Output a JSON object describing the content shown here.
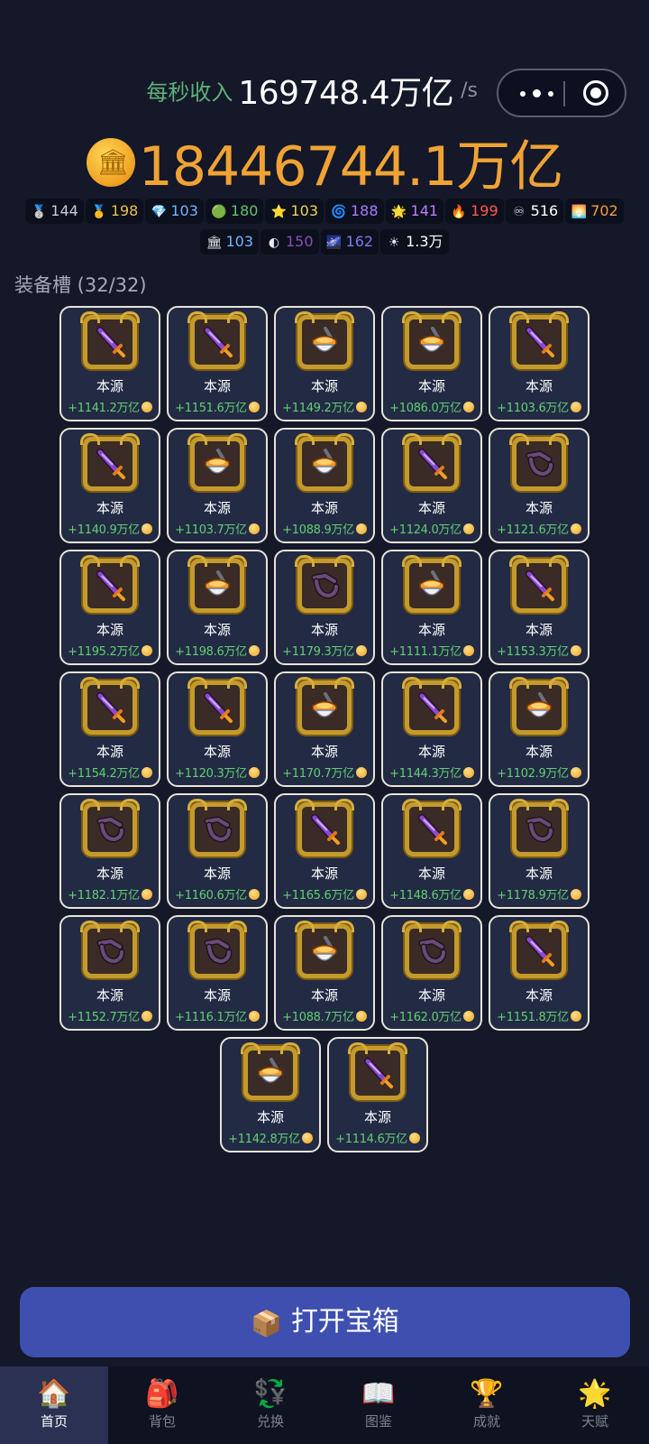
{
  "header": {
    "income_label": "每秒收入",
    "income_value": "169748.4万亿",
    "income_unit": "/s",
    "balance_value": "18446744.1万亿"
  },
  "badges_row1": [
    {
      "icon": "silver-medal-icon",
      "glyph": "🥈",
      "value": "144",
      "color": "#c8ccd6"
    },
    {
      "icon": "gold-medal-icon",
      "glyph": "🥇",
      "value": "198",
      "color": "#e8c04a"
    },
    {
      "icon": "diamond-icon",
      "glyph": "💎",
      "value": "103",
      "color": "#6fb6ff"
    },
    {
      "icon": "green-orb-icon",
      "glyph": "🟢",
      "value": "180",
      "color": "#62c26a"
    },
    {
      "icon": "star-icon",
      "glyph": "⭐",
      "value": "103",
      "color": "#f2d05a"
    },
    {
      "icon": "galaxy-icon",
      "glyph": "🌀",
      "value": "188",
      "color": "#a77bff"
    },
    {
      "icon": "sun-icon",
      "glyph": "🌟",
      "value": "141",
      "color": "#c07cff"
    },
    {
      "icon": "fire-icon",
      "glyph": "🔥",
      "value": "199",
      "color": "#ff5a4a"
    },
    {
      "icon": "infinity-icon",
      "glyph": "♾",
      "value": "516",
      "color": "#ffffff"
    },
    {
      "icon": "sunrise-icon",
      "glyph": "🌅",
      "value": "702",
      "color": "#f0a03a"
    }
  ],
  "badges_row2": [
    {
      "icon": "bank-icon",
      "glyph": "🏛",
      "value": "103",
      "color": "#6fb6ff"
    },
    {
      "icon": "black-hole-icon",
      "glyph": "◐",
      "value": "150",
      "color": "#8a4fb8"
    },
    {
      "icon": "nebula-icon",
      "glyph": "🌌",
      "value": "162",
      "color": "#7a7cf0"
    },
    {
      "icon": "sun-icon",
      "glyph": "☀",
      "value": "1.3万",
      "color": "#ffffff"
    }
  ],
  "slot_title": "装备槽 (32/32)",
  "cards": [
    {
      "name": "本源",
      "value": "+1141.2万亿",
      "art": "sword"
    },
    {
      "name": "本源",
      "value": "+1151.6万亿",
      "art": "sword"
    },
    {
      "name": "本源",
      "value": "+1149.2万亿",
      "art": "cauldron"
    },
    {
      "name": "本源",
      "value": "+1086.0万亿",
      "art": "cauldron"
    },
    {
      "name": "本源",
      "value": "+1103.6万亿",
      "art": "sword"
    },
    {
      "name": "本源",
      "value": "+1140.9万亿",
      "art": "sword"
    },
    {
      "name": "本源",
      "value": "+1103.7万亿",
      "art": "cauldron"
    },
    {
      "name": "本源",
      "value": "+1088.9万亿",
      "art": "cauldron"
    },
    {
      "name": "本源",
      "value": "+1124.0万亿",
      "art": "sword"
    },
    {
      "name": "本源",
      "value": "+1121.6万亿",
      "art": "anchor"
    },
    {
      "name": "本源",
      "value": "+1195.2万亿",
      "art": "sword"
    },
    {
      "name": "本源",
      "value": "+1198.6万亿",
      "art": "cauldron"
    },
    {
      "name": "本源",
      "value": "+1179.3万亿",
      "art": "anchor"
    },
    {
      "name": "本源",
      "value": "+1111.1万亿",
      "art": "cauldron"
    },
    {
      "name": "本源",
      "value": "+1153.3万亿",
      "art": "sword"
    },
    {
      "name": "本源",
      "value": "+1154.2万亿",
      "art": "sword"
    },
    {
      "name": "本源",
      "value": "+1120.3万亿",
      "art": "sword"
    },
    {
      "name": "本源",
      "value": "+1170.7万亿",
      "art": "cauldron"
    },
    {
      "name": "本源",
      "value": "+1144.3万亿",
      "art": "sword"
    },
    {
      "name": "本源",
      "value": "+1102.9万亿",
      "art": "cauldron"
    },
    {
      "name": "本源",
      "value": "+1182.1万亿",
      "art": "anchor"
    },
    {
      "name": "本源",
      "value": "+1160.6万亿",
      "art": "anchor"
    },
    {
      "name": "本源",
      "value": "+1165.6万亿",
      "art": "sword"
    },
    {
      "name": "本源",
      "value": "+1148.6万亿",
      "art": "sword"
    },
    {
      "name": "本源",
      "value": "+1178.9万亿",
      "art": "anchor"
    },
    {
      "name": "本源",
      "value": "+1152.7万亿",
      "art": "anchor"
    },
    {
      "name": "本源",
      "value": "+1116.1万亿",
      "art": "anchor"
    },
    {
      "name": "本源",
      "value": "+1088.7万亿",
      "art": "cauldron"
    },
    {
      "name": "本源",
      "value": "+1162.0万亿",
      "art": "anchor"
    },
    {
      "name": "本源",
      "value": "+1151.8万亿",
      "art": "sword"
    },
    {
      "name": "本源",
      "value": "+1142.8万亿",
      "art": "cauldron"
    },
    {
      "name": "本源",
      "value": "+1114.6万亿",
      "art": "sword"
    }
  ],
  "open_button": {
    "icon": "box-icon",
    "glyph": "📦",
    "label": "打开宝箱"
  },
  "tabs": [
    {
      "icon": "home-icon",
      "glyph": "🏠",
      "label": "首页",
      "active": true
    },
    {
      "icon": "backpack-icon",
      "glyph": "🎒",
      "label": "背包",
      "active": false
    },
    {
      "icon": "exchange-icon",
      "glyph": "💱",
      "label": "兑换",
      "active": false
    },
    {
      "icon": "book-icon",
      "glyph": "📖",
      "label": "图鉴",
      "active": false
    },
    {
      "icon": "trophy-icon",
      "glyph": "🏆",
      "label": "成就",
      "active": false
    },
    {
      "icon": "starburst-icon",
      "glyph": "🌟",
      "label": "天赋",
      "active": false
    }
  ]
}
